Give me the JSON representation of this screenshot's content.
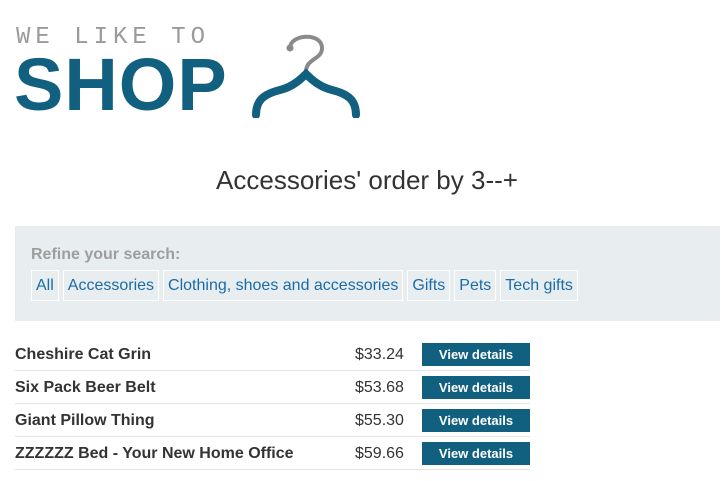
{
  "logo": {
    "top_text": "WE LIKE TO",
    "main_text": "SHOP"
  },
  "heading": "Accessories' order by 3--+",
  "filters": {
    "label": "Refine your search:",
    "categories": [
      "All",
      "Accessories",
      "Clothing, shoes and accessories",
      "Gifts",
      "Pets",
      "Tech gifts"
    ]
  },
  "products": [
    {
      "name": "Cheshire Cat Grin",
      "price": "$33.24",
      "button": "View details"
    },
    {
      "name": "Six Pack Beer Belt",
      "price": "$53.68",
      "button": "View details"
    },
    {
      "name": "Giant Pillow Thing",
      "price": "$55.30",
      "button": "View details"
    },
    {
      "name": "ZZZZZZ Bed - Your New Home Office",
      "price": "$59.66",
      "button": "View details"
    }
  ],
  "colors": {
    "brand": "#12607f",
    "link": "#1a6ca8",
    "filter_bg": "#e8edf0"
  },
  "icons": {
    "logo_icon": "hanger-icon"
  }
}
